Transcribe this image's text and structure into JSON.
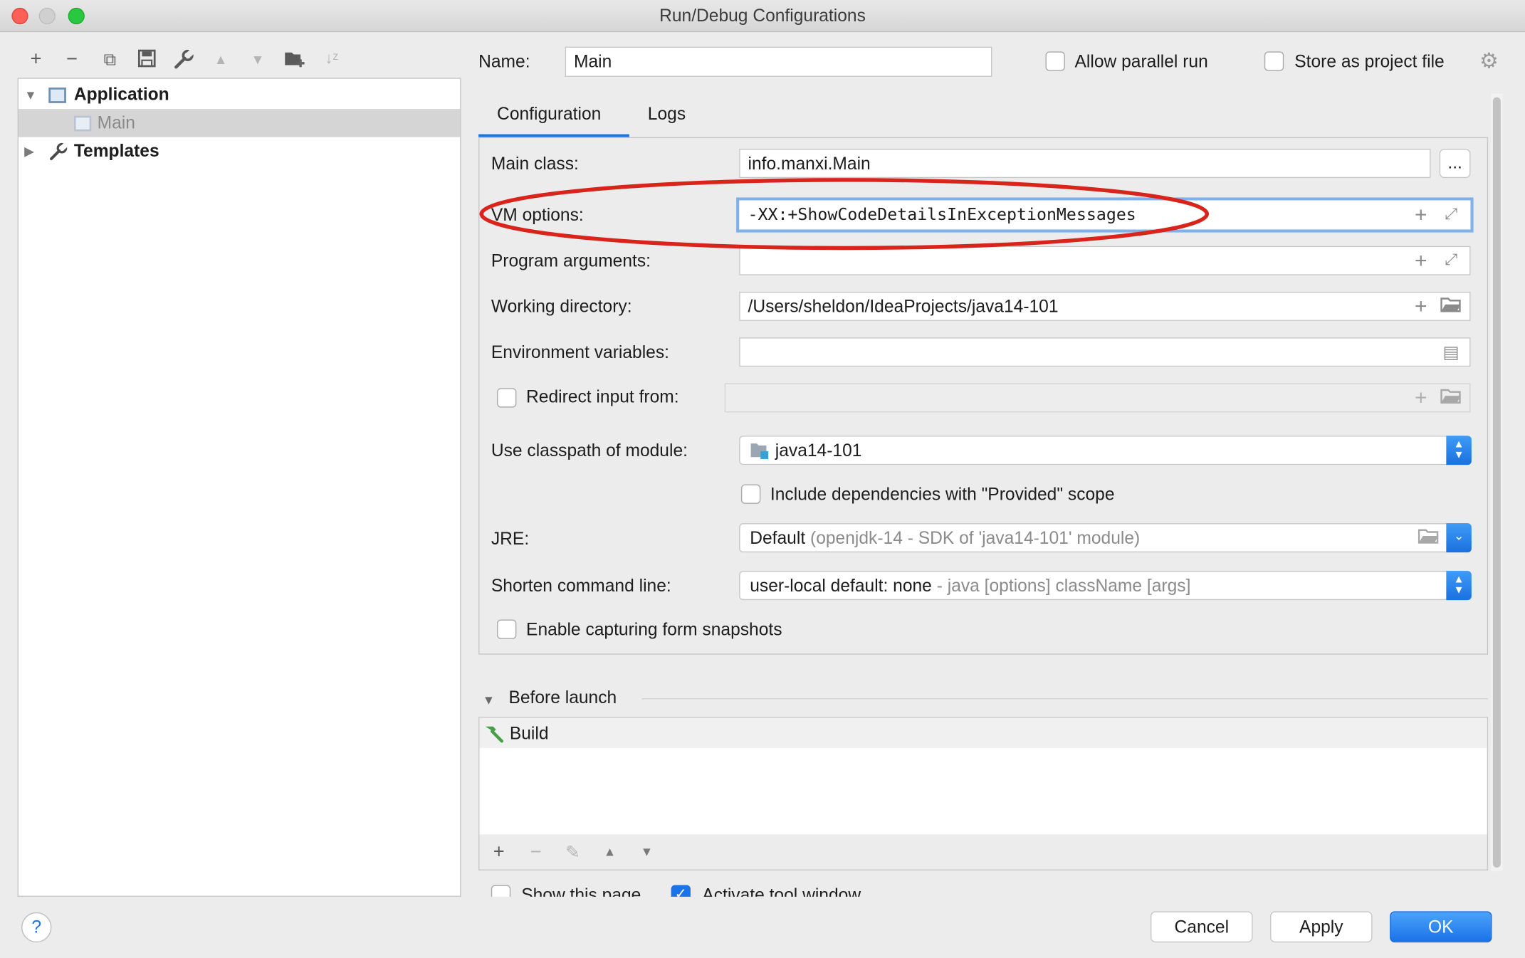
{
  "window": {
    "title": "Run/Debug Configurations"
  },
  "tree": {
    "items": [
      {
        "label": "Application"
      },
      {
        "label": "Main"
      },
      {
        "label": "Templates"
      }
    ]
  },
  "header": {
    "name_label": "Name:",
    "name_value": "Main",
    "allow_parallel_label": "Allow parallel run",
    "store_project_label": "Store as project file"
  },
  "tabs": [
    {
      "label": "Configuration",
      "active": true
    },
    {
      "label": "Logs",
      "active": false
    }
  ],
  "form": {
    "main_class_label": "Main class:",
    "main_class_value": "info.manxi.Main",
    "browse_label": "...",
    "vm_options_label": "VM options:",
    "vm_options_value": "-XX:+ShowCodeDetailsInExceptionMessages",
    "program_args_label": "Program arguments:",
    "program_args_value": "",
    "working_dir_label": "Working directory:",
    "working_dir_value": "/Users/sheldon/IdeaProjects/java14-101",
    "env_vars_label": "Environment variables:",
    "env_vars_value": "",
    "redirect_label": "Redirect input from:",
    "classpath_label": "Use classpath of module:",
    "classpath_value": "java14-101",
    "include_deps_label": "Include dependencies with \"Provided\" scope",
    "jre_label": "JRE:",
    "jre_value": "Default",
    "jre_hint": "(openjdk-14 - SDK of 'java14-101' module)",
    "shorten_label": "Shorten command line:",
    "shorten_value": "user-local default: none",
    "shorten_hint": "- java [options] className [args]",
    "snapshots_label": "Enable capturing form snapshots"
  },
  "before_launch": {
    "title": "Before launch",
    "items": [
      {
        "label": "Build"
      }
    ]
  },
  "footer": {
    "show_page_label": "Show this page",
    "activate_tool_label": "Activate tool window",
    "cancel_label": "Cancel",
    "apply_label": "Apply",
    "ok_label": "OK",
    "help_label": "?"
  },
  "colors": {
    "accent": "#1a73e8",
    "annotation": "#d9241b",
    "selection": "#d5d5d5"
  }
}
